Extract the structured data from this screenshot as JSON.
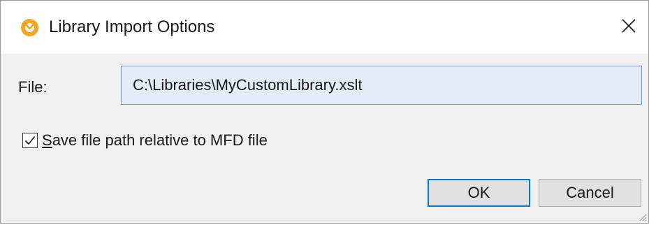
{
  "window": {
    "title": "Library Import Options",
    "icon": "altova-mapforce-icon",
    "close_icon": "close-icon"
  },
  "form": {
    "file_label": "File:",
    "file_value": "C:\\Libraries\\MyCustomLibrary.xslt",
    "checkbox_label": "Save file path relative to MFD file",
    "checkbox_checked": true
  },
  "buttons": {
    "ok": "OK",
    "cancel": "Cancel"
  },
  "colors": {
    "title_bg": "#ffffff",
    "content_bg": "#f0f0f0",
    "input_bg": "#e3ecf7",
    "default_button_border": "#0078d7",
    "icon_orange": "#f5a623"
  }
}
